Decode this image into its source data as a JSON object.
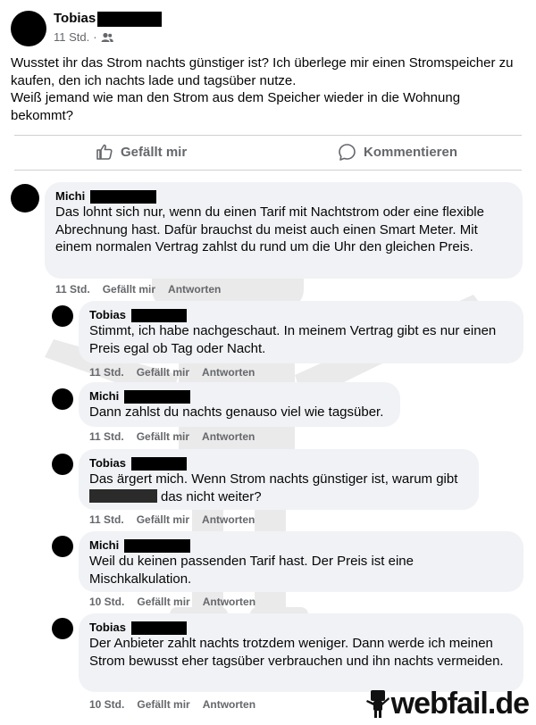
{
  "post": {
    "author": "Tobias",
    "time": "11 Std.",
    "audience_icon": "friends-icon",
    "paragraph1": "Wusstet ihr das Strom nachts günstiger ist? Ich überlege mir einen Stromspeicher zu kaufen, den ich nachts lade und tagsüber nutze.",
    "paragraph2": "Weiß jemand wie man den Strom aus dem Speicher wieder in die Wohnung bekommt?"
  },
  "actions": {
    "like_label": "Gefällt mir",
    "comment_label": "Kommentieren"
  },
  "comments": [
    {
      "author": "Michi",
      "text": "Das lohnt sich nur, wenn du einen Tarif mit Nachtstrom oder eine flexible Abrechnung hast. Dafür brauchst du meist auch einen Smart Meter. Mit einem normalen Vertrag zahlst du rund um die Uhr den gleichen Preis.",
      "time": "11 Std.",
      "like": "Gefällt mir",
      "reply": "Antworten"
    },
    {
      "author": "Tobias",
      "text": "Stimmt, ich habe nachgeschaut. In meinem Vertrag gibt es nur einen Preis egal ob Tag oder Nacht.",
      "time": "11 Std.",
      "like": "Gefällt mir",
      "reply": "Antworten"
    },
    {
      "author": "Michi",
      "text": "Dann zahlst du nachts genauso viel wie tagsüber.",
      "time": "11 Std.",
      "like": "Gefällt mir",
      "reply": "Antworten"
    },
    {
      "author": "Tobias",
      "text_before": "Das ärgert mich. Wenn Strom nachts günstiger ist, warum gibt",
      "text_after": "das nicht weiter?",
      "time": "11 Std.",
      "like": "Gefällt mir",
      "reply": "Antworten"
    },
    {
      "author": "Michi",
      "text": "Weil du keinen passenden Tarif hast. Der Preis ist eine Mischkalkulation.",
      "time": "10 Std.",
      "like": "Gefällt mir",
      "reply": "Antworten"
    },
    {
      "author": "Tobias",
      "text": "Der Anbieter zahlt nachts trotzdem weniger. Dann werde ich meinen Strom bewusst eher tagsüber verbrauchen und ihn nachts vermeiden.",
      "time": "10 Std.",
      "like": "Gefällt mir",
      "reply": "Antworten"
    }
  ],
  "watermark": {
    "brand": "webfail.de"
  }
}
